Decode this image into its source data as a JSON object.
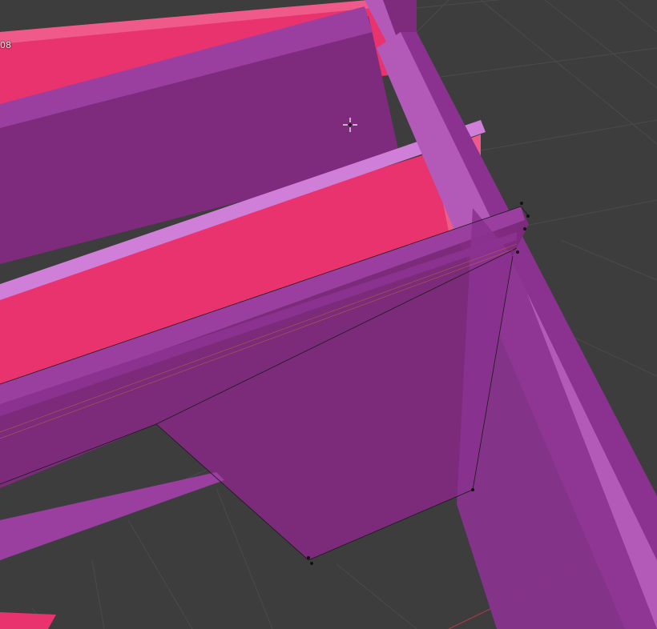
{
  "viewport": {
    "overlay_value": "08",
    "background_color": "#3d3d3d",
    "grid_color": "#4a4a4a",
    "axis_x_color": "#a83a48",
    "mesh_colors": {
      "pink": "#e8336e",
      "purple": "#7e2a7d",
      "light_purple": "#b35ab8",
      "highlight": "#d07fd8"
    },
    "cursor_icon": "3d-cursor-icon"
  }
}
